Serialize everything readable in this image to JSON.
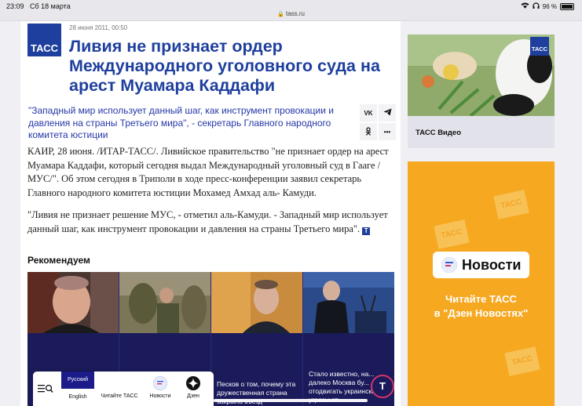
{
  "status_bar": {
    "time": "23:09",
    "date": "Сб 18 марта",
    "url": "tass.ru",
    "battery": "96 %"
  },
  "article": {
    "logo": "ТАСС",
    "date": "28 июня 2011, 00:50",
    "title": "Ливия не признает ордер Международного уголовного суда на арест Муамара Каддафи",
    "lead": "\"Западный мир использует данный шаг, как инструмент провокации и давления на страны Третьего мира\", - секретарь Главного народного комитета юстиции",
    "paragraphs": [
      "КАИР, 28 июня. /ИТАР-ТАСС/. Ливийское правительство \"не признает ордер на арест Муамара Каддафи, который сегодня выдал Международный уголовный суд в Гааге / МУС/\". Об этом сегодня в Триполи в ходе пресс-конференции заявил секретарь Главного народного комитета юстиции Мохамед Амхад аль- Камуди.",
      "\"Ливия не признает решение МУС, - отметил аль-Камуди. - Западный мир использует данный шаг, как инструмент провокации и давления на страны Третьего мира\"."
    ],
    "end_badge": "Т"
  },
  "share": {
    "vk": "VK",
    "telegram_icon": "paper-plane-icon",
    "ok_icon": "odnoklassniki-icon",
    "more": "•••"
  },
  "recommend": {
    "heading": "Рекомендуем",
    "cards": [
      {
        "text": ""
      },
      {
        "text": ""
      },
      {
        "text": "Песков о том, почему эта дружественная страна закрыла въезд"
      },
      {
        "text": "Стало известно, на... далеко Москва бу... отодвигать украинские угрозы от"
      }
    ]
  },
  "dock": {
    "lang_ru": "Русский",
    "lang_en": "English",
    "read_tass": "Читайте ТАСС",
    "news": "Новости",
    "dzen": "Дзен"
  },
  "fab": "T",
  "sidebar": {
    "logo": "ТАСС",
    "video_label": "ТАСС Видео",
    "promo_watermark": "ТАСС",
    "promo_brand": "Новости",
    "promo_line1": "Читайте ТАСС",
    "promo_line2": "в \"Дзен Новостях\""
  }
}
